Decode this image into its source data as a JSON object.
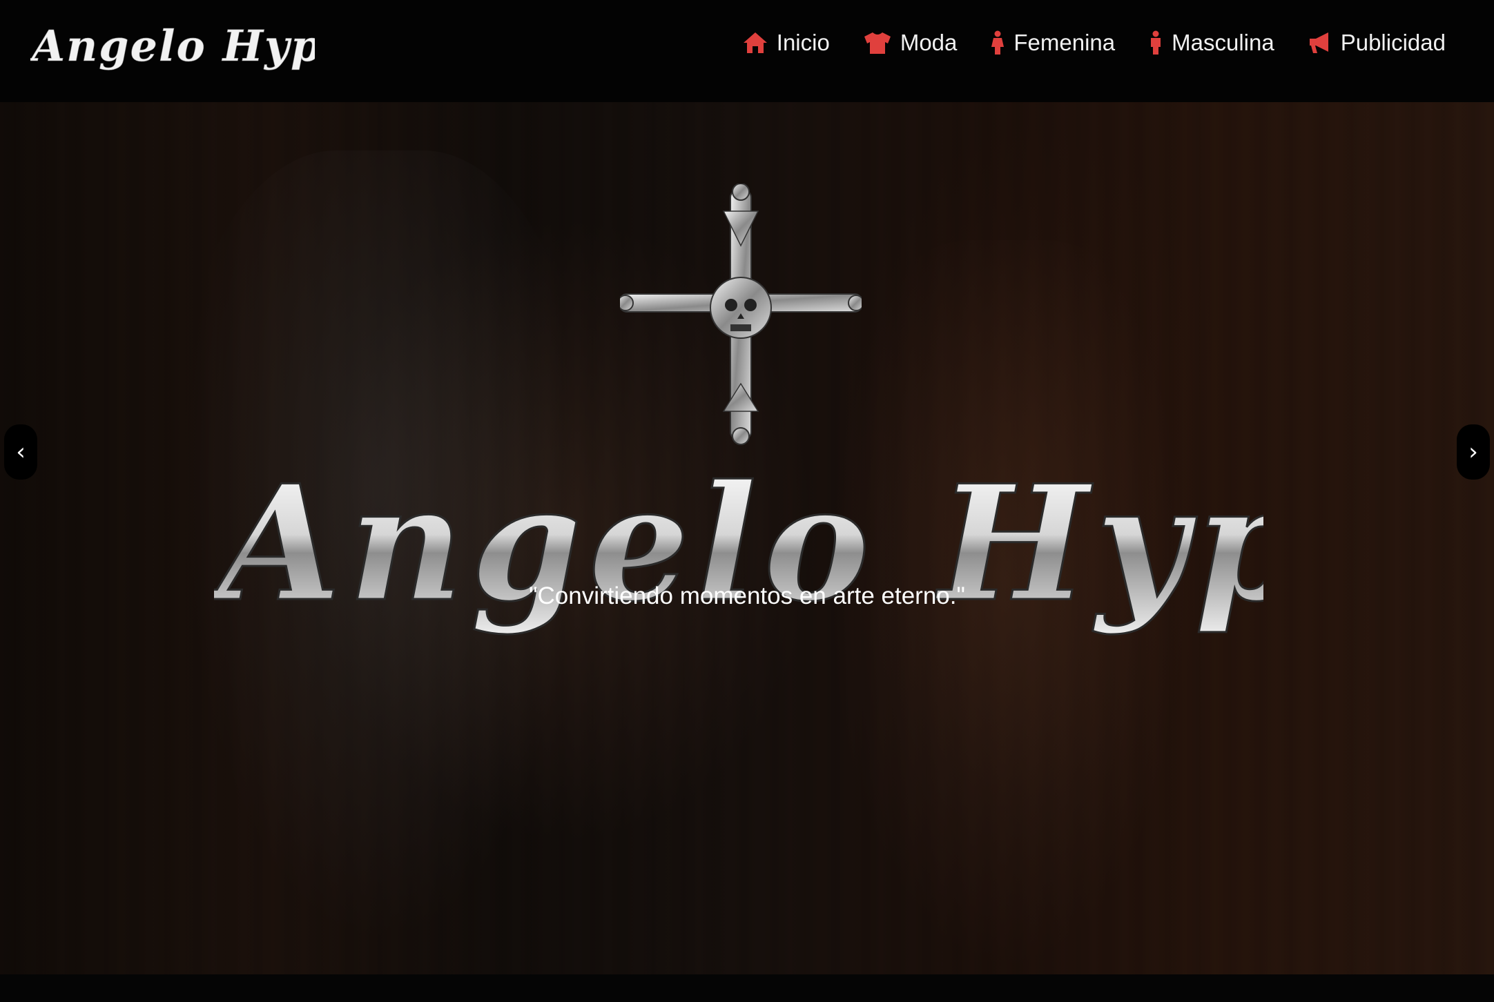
{
  "brand": {
    "logo_text": "Angelo Hype"
  },
  "nav": {
    "items": [
      {
        "label": "Inicio",
        "icon": "home-icon"
      },
      {
        "label": "Moda",
        "icon": "tshirt-icon"
      },
      {
        "label": "Femenina",
        "icon": "female-icon"
      },
      {
        "label": "Masculina",
        "icon": "male-icon"
      },
      {
        "label": "Publicidad",
        "icon": "megaphone-icon"
      }
    ],
    "icon_color": "#e0403d"
  },
  "hero": {
    "title_text": "Angelo Hype",
    "tagline": "\"Convirtiendo momentos en arte eterno.\"",
    "prev_arrow": "‹",
    "next_arrow": "›"
  }
}
